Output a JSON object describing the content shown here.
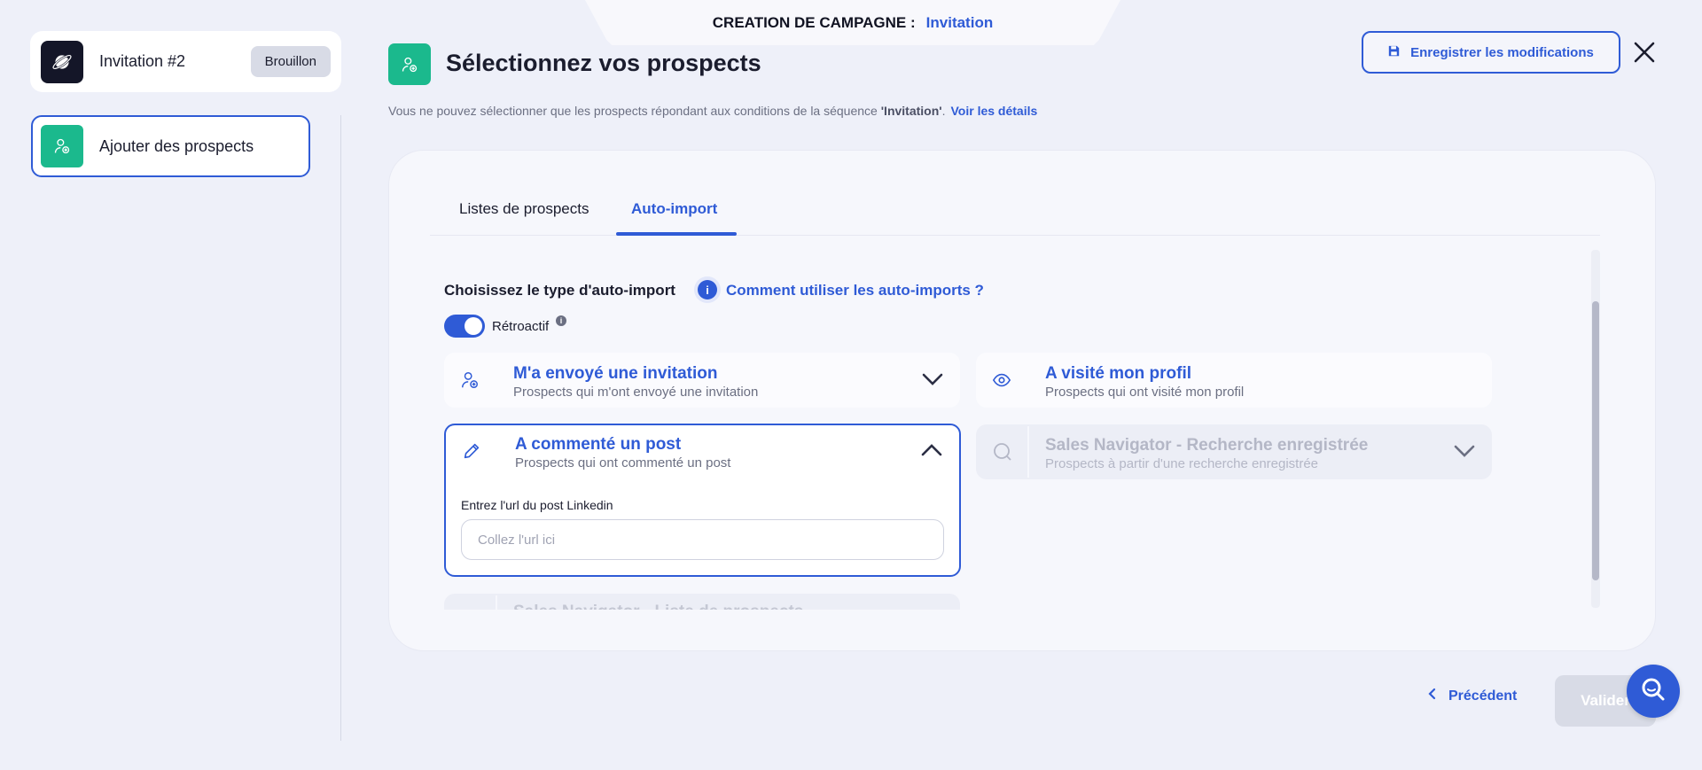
{
  "banner": {
    "prefix": "CREATION DE CAMPAGNE :",
    "campaign_name": "Invitation"
  },
  "sidebar": {
    "campaign_title": "Invitation #2",
    "status_badge": "Brouillon",
    "steps": [
      {
        "label": "Ajouter des prospects"
      }
    ]
  },
  "header": {
    "title": "Sélectionnez vos prospects",
    "subtitle_text": "Vous ne pouvez sélectionner que les prospects répondant aux conditions de la séquence ",
    "subtitle_sequence": "'Invitation'",
    "subtitle_dot": ".",
    "details_link": "Voir les détails",
    "save_label": "Enregistrer les modifications"
  },
  "tabs": [
    {
      "label": "Listes de prospects",
      "active": false
    },
    {
      "label": "Auto-import",
      "active": true
    }
  ],
  "autoimport": {
    "choose_label": "Choisissez le type d'auto-import",
    "howto_link": "Comment utiliser les auto-imports ?",
    "info_glyph": "i",
    "retro_label": "Rétroactif",
    "retro_enabled": true,
    "options": {
      "invite": {
        "title": "M'a envoyé une invitation",
        "desc": "Prospects qui m'ont envoyé une invitation",
        "icon": "user-add-icon"
      },
      "visit": {
        "title": "A visité mon profil",
        "desc": "Prospects qui ont visité mon profil",
        "icon": "eye-icon"
      },
      "comment": {
        "title": "A commenté un post",
        "desc": "Prospects qui ont commenté un post",
        "icon": "pencil-icon",
        "url_label": "Entrez l'url du post Linkedin",
        "url_placeholder": "Collez l'url ici",
        "url_value": ""
      },
      "salesnav_search": {
        "title": "Sales Navigator - Recherche enregistrée",
        "desc": "Prospects à partir d'une recherche enregistrée",
        "icon": "search-icon"
      },
      "salesnav_list": {
        "title": "Sales Navigator - Liste de prospects"
      }
    }
  },
  "footer": {
    "prev_label": "Précédent",
    "validate_label": "Valider"
  },
  "colors": {
    "accent": "#2f5bd6",
    "green": "#1bb98d",
    "background": "#eef0f9",
    "disabled": "#d8dbe6"
  }
}
